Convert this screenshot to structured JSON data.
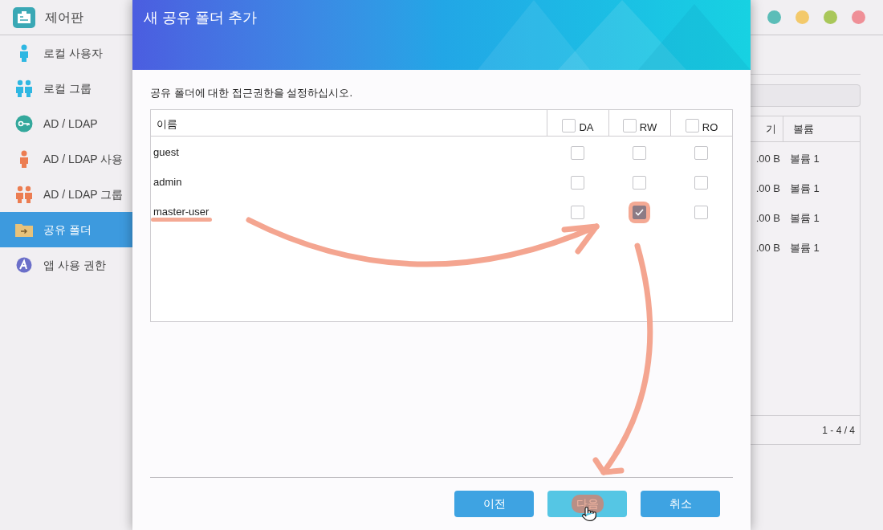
{
  "app": {
    "title": "제어판"
  },
  "window_controls": [
    {
      "color": "#5bbdb8"
    },
    {
      "color": "#f3c96b"
    },
    {
      "color": "#a9c75a"
    },
    {
      "color": "#ef8f97"
    }
  ],
  "sidebar": {
    "items": [
      {
        "label": "로컬 사용자",
        "selected": false
      },
      {
        "label": "로컬 그룹",
        "selected": false
      },
      {
        "label": "AD / LDAP",
        "selected": false
      },
      {
        "label": "AD / LDAP 사용",
        "selected": false
      },
      {
        "label": "AD / LDAP 그룹",
        "selected": false
      },
      {
        "label": "공유 폴더",
        "selected": true
      },
      {
        "label": "앱 사용 권한",
        "selected": false
      }
    ]
  },
  "background_table": {
    "columns": [
      "기",
      "볼륨"
    ],
    "rows": [
      [
        ".00 B",
        "볼륨 1"
      ],
      [
        ".00 B",
        "볼륨 1"
      ],
      [
        ".00 B",
        "볼륨 1"
      ],
      [
        ".00 B",
        "볼륨 1"
      ]
    ],
    "pagination": "1 - 4 / 4"
  },
  "dialog": {
    "title": "새 공유 폴더 추가",
    "instruction": "공유 폴더에 대한 접근권한을 설정하십시오.",
    "table": {
      "name_column": "이름",
      "permission_columns": [
        {
          "label": "DA",
          "checked": false
        },
        {
          "label": "RW",
          "checked": false
        },
        {
          "label": "RO",
          "checked": false
        }
      ],
      "rows": [
        {
          "name": "guest",
          "permissions": [
            {
              "checked": false
            },
            {
              "checked": false
            },
            {
              "checked": false
            }
          ]
        },
        {
          "name": "admin",
          "permissions": [
            {
              "checked": false
            },
            {
              "checked": false
            },
            {
              "checked": false
            }
          ]
        },
        {
          "name": "master-user",
          "permissions": [
            {
              "checked": false
            },
            {
              "checked": true
            },
            {
              "checked": false
            }
          ]
        }
      ]
    },
    "buttons": [
      {
        "label": "이전",
        "highlighted": false
      },
      {
        "label": "다음",
        "highlighted": true
      },
      {
        "label": "취소",
        "highlighted": false
      }
    ]
  }
}
